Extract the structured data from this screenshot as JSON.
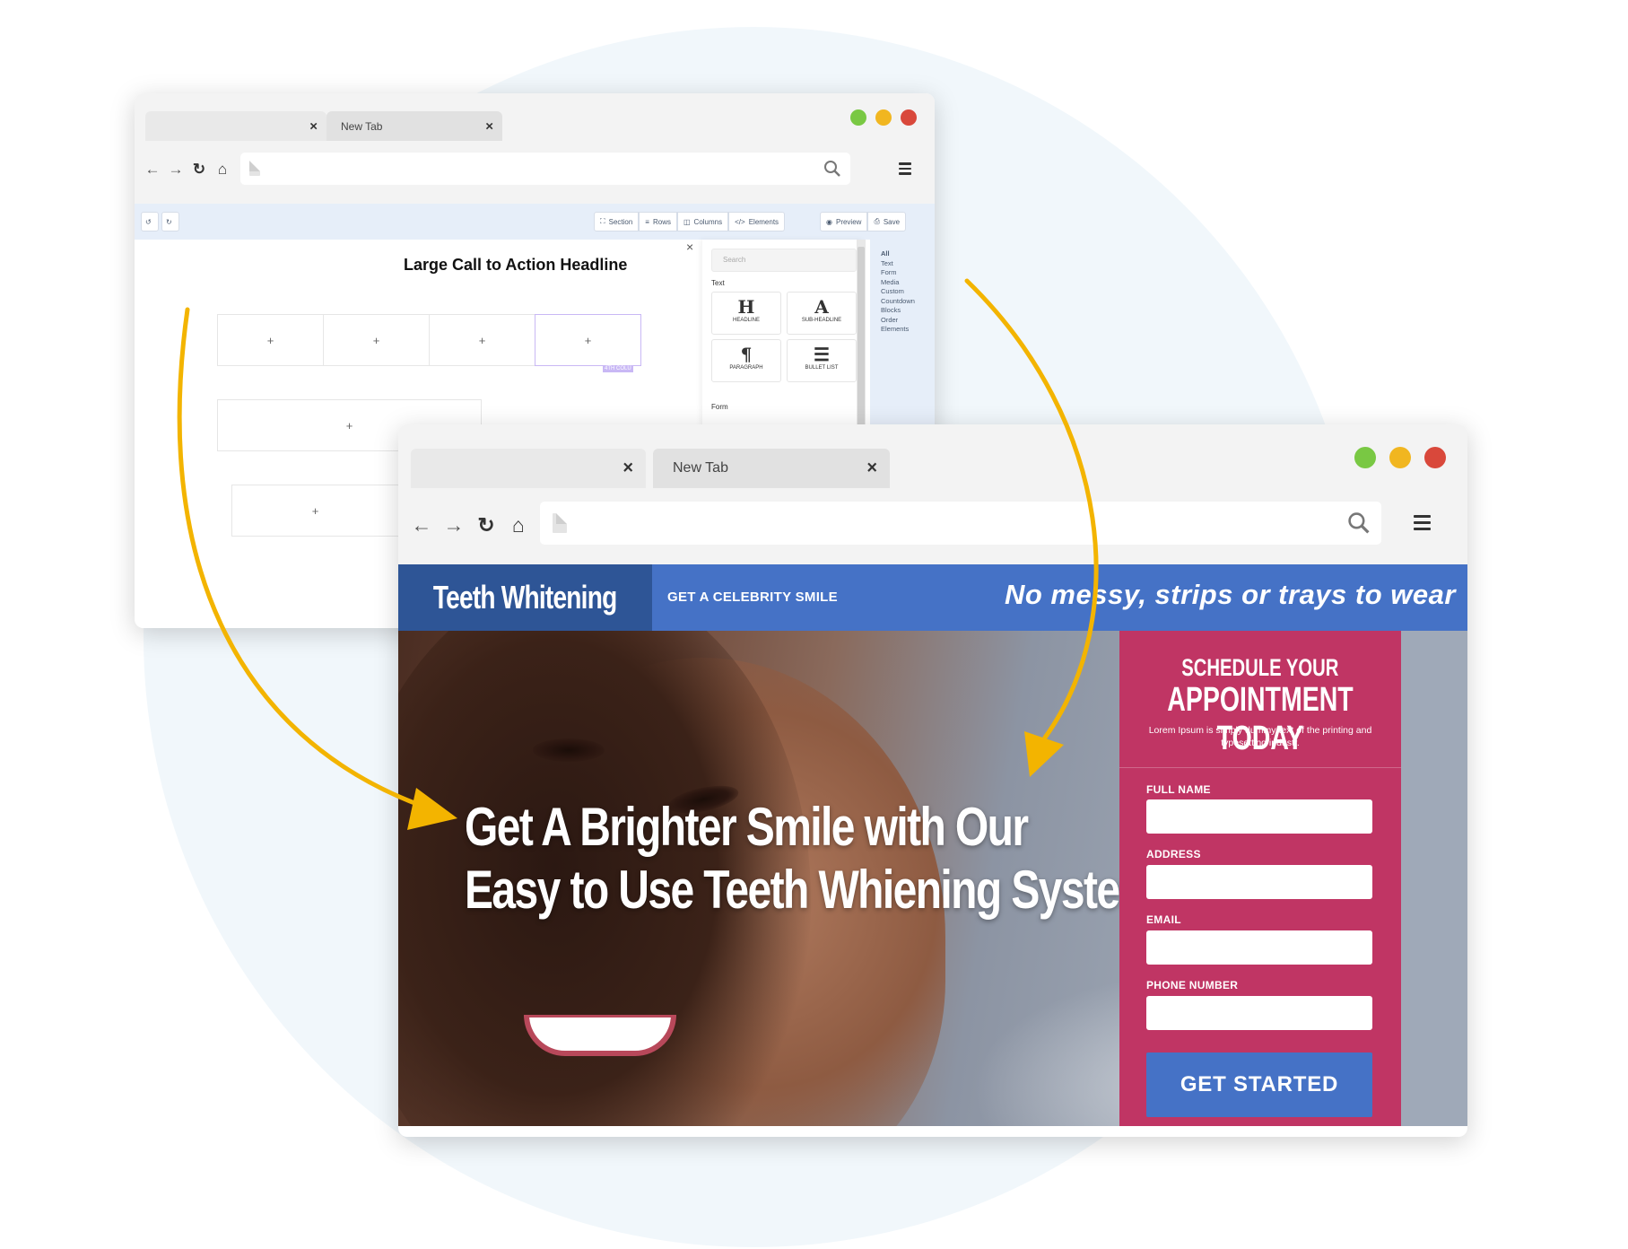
{
  "editor_window": {
    "tabs": [
      {
        "label": "",
        "close": "×"
      },
      {
        "label": "New Tab",
        "close": "×"
      }
    ],
    "window_dots": [
      "#79c843",
      "#f1b620",
      "#d9483b"
    ],
    "toolbar": {
      "undo": "↺",
      "redo": "↻",
      "buttons": [
        {
          "icon": "⛶",
          "label": "Section"
        },
        {
          "icon": "≡",
          "label": "Rows"
        },
        {
          "icon": "◫",
          "label": "Columns"
        },
        {
          "icon": "</>",
          "label": "Elements"
        },
        {
          "icon": "◉",
          "label": "Preview"
        },
        {
          "icon": "⎙",
          "label": "Save"
        }
      ]
    },
    "canvas": {
      "headline": "Large Call to Action Headline",
      "plus": "+",
      "selected_tag": "4TH COLU"
    },
    "panel": {
      "close": "×",
      "search_placeholder": "Search",
      "section_text": "Text",
      "section_form": "Form",
      "elements": [
        {
          "glyph": "H",
          "name": "HEADLINE"
        },
        {
          "glyph": "A",
          "name": "SUB-HEADLINE"
        },
        {
          "glyph": "¶",
          "name": "PARAGRAPH"
        },
        {
          "glyph": "☰",
          "name": "BULLET LIST"
        }
      ],
      "categories": [
        "All",
        "Text",
        "Form",
        "Media",
        "Custom",
        "Countdown",
        "Blocks",
        "Order",
        "Elements"
      ]
    }
  },
  "landing_window": {
    "tabs": [
      {
        "label": "",
        "close": "×"
      },
      {
        "label": "New Tab",
        "close": "×"
      }
    ],
    "window_dots": [
      "#79c843",
      "#f1b620",
      "#d9483b"
    ],
    "header": {
      "brand": "Teeth Whitening",
      "tagline": "GET A CELEBRITY SMILE",
      "slogan": "No messy, strips or trays to wear"
    },
    "hero": {
      "line1": "Get A Brighter Smile with Our",
      "line2": "Easy to Use Teeth Whiening System"
    },
    "form": {
      "title1": "SCHEDULE YOUR",
      "title2": "APPOINTMENT TODAY",
      "description": "Lorem Ipsum is simply dummy text of the printing and typesetting industr.",
      "fields": [
        {
          "label": "FULL NAME",
          "value": ""
        },
        {
          "label": "ADDRESS",
          "value": ""
        },
        {
          "label": "EMAIL",
          "value": ""
        },
        {
          "label": "PHONE NUMBER",
          "value": ""
        }
      ],
      "submit": "GET STARTED"
    },
    "colors": {
      "header_blue": "#4572c6",
      "brand_blue": "#2e5596",
      "form_pink": "#c03564",
      "arrow": "#f3b400"
    }
  }
}
